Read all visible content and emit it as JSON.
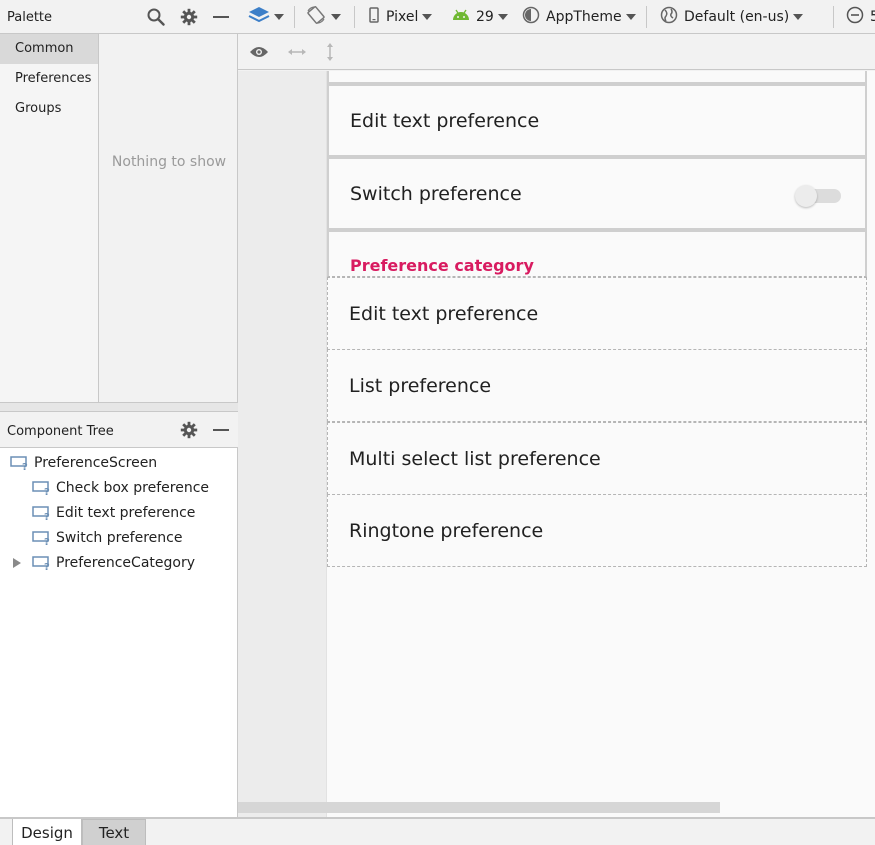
{
  "palette": {
    "title": "Palette",
    "categories": [
      "Common",
      "Preferences",
      "Groups"
    ],
    "active_category": "Common",
    "empty_text": "Nothing to show"
  },
  "component_tree": {
    "title": "Component Tree",
    "root": "PreferenceScreen",
    "children": [
      "Check box preference",
      "Edit text preference",
      "Switch preference",
      "PreferenceCategory"
    ]
  },
  "toolbar": {
    "device": "Pixel",
    "api_level": "29",
    "theme": "AppTheme",
    "locale": "Default (en-us)",
    "zoom_partial": "5"
  },
  "preview": {
    "items": [
      {
        "label": "Edit text preference"
      },
      {
        "label": "Switch preference"
      },
      {
        "label": "Preference category"
      },
      {
        "label": "Edit text preference"
      },
      {
        "label": "List preference"
      },
      {
        "label": "Multi select list preference"
      },
      {
        "label": "Ringtone preference"
      }
    ],
    "category_color": "#d81b60"
  },
  "bottom_tabs": {
    "design": "Design",
    "text": "Text",
    "active": "Design"
  }
}
